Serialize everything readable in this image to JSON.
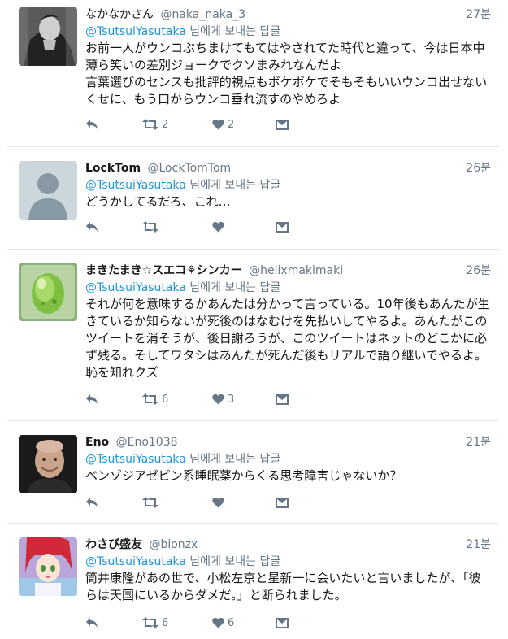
{
  "reply_prefix": "님에게 보내는 답글",
  "tweets": [
    {
      "name": "なかなかさん",
      "handle": "@naka_naka_3",
      "time": "27분",
      "reply_to": "@TsutsuiYasutaka",
      "text": "お前一人がウンコぶちまけてもてはやされてた時代と違って、今は日本中薄ら笑いの差別ジョークでクソまみれなんだよ\n言葉選びのセンスも批評的視点もボケボケでそもそもいいウンコ出せないくせに、もう口からウンコ垂れ流すのやめろよ",
      "retweets": "2",
      "likes": "2"
    },
    {
      "name": "LockTom",
      "handle": "@LockTomTom",
      "time": "26분",
      "reply_to": "@TsutsuiYasutaka",
      "text": "どうかしてるだろ、これ…",
      "retweets": "",
      "likes": ""
    },
    {
      "name": "まきたまき☆スエコ⚘シンカー",
      "handle": "@helixmakimaki",
      "time": "26분",
      "reply_to": "@TsutsuiYasutaka",
      "text": "それが何を意味するかあんたは分かって言っている。10年後もあんたが生きているか知らないが死後のはなむけを先払いしてやるよ。あんたがこのツイートを消そうが、後日謝ろうが、このツイートはネットのどこかに必ず残る。そしてワタシはあんたが死んだ後もリアルで語り継いでやるよ。恥を知れクズ",
      "retweets": "6",
      "likes": "3"
    },
    {
      "name": "Eno",
      "handle": "@Eno1038",
      "time": "21분",
      "reply_to": "@TsutsuiYasutaka",
      "text": "ベンゾジアゼピン系睡眠薬からくる思考障害じゃないか？",
      "retweets": "",
      "likes": ""
    },
    {
      "name": "わさび盛友",
      "handle": "@bionzx",
      "time": "21분",
      "reply_to": "@TsutsuiYasutaka",
      "text": "筒井康隆があの世で、小松左京と星新一に会いたいと言いましたが、「彼らは天国にいるからダメだ。」と断られました。",
      "retweets": "6",
      "likes": "6"
    }
  ],
  "icons": {
    "reply": "reply-arrow-icon",
    "retweet": "retweet-icon",
    "like": "heart-icon",
    "dm": "envelope-icon"
  },
  "colors": {
    "mention": "#1b95e0",
    "secondary": "#657786",
    "text": "#14171a",
    "divider": "#e1e8ed"
  }
}
